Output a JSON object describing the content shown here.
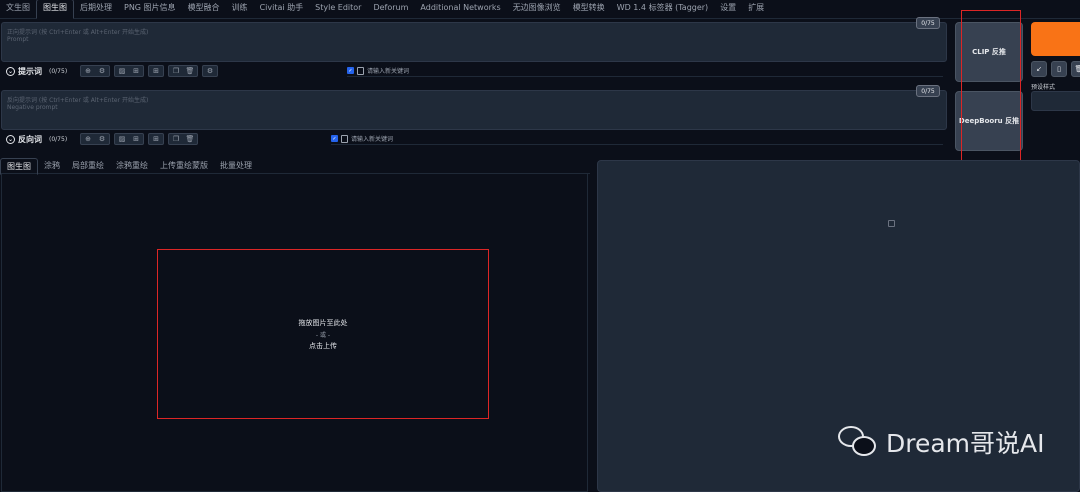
{
  "nav_tabs": [
    "文生图",
    "图生图",
    "后期处理",
    "PNG 图片信息",
    "模型融合",
    "训练",
    "Civitai 助手",
    "Style Editor",
    "Deforum",
    "Additional Networks",
    "无边图像浏览",
    "模型转换",
    "WD 1.4 标签器 (Tagger)",
    "设置",
    "扩展"
  ],
  "active_nav": "图生图",
  "prompt": {
    "hint_cn": "正向提示词 (按 Ctrl+Enter 或 Alt+Enter 开始生成)",
    "hint_en": "Prompt",
    "counter": "0/75",
    "title": "提示词",
    "title_count": "(0/75)",
    "keyword_placeholder": "请输入新关键词"
  },
  "negative": {
    "hint_cn": "反向提示词 (按 Ctrl+Enter 或 Alt+Enter 开始生成)",
    "hint_en": "Negative prompt",
    "counter": "0/75",
    "title": "反向词",
    "title_count": "(0/75)",
    "keyword_placeholder": "请输入新关键词"
  },
  "side": {
    "clip_label": "CLIP 反推",
    "deepbooru_label": "DeepBooru 反推",
    "styles_label": "预设样式"
  },
  "sub_tabs": [
    "图生图",
    "涂鸦",
    "局部重绘",
    "涂鸦重绘",
    "上传重绘蒙版",
    "批量处理"
  ],
  "upload": {
    "line1": "拖放图片至此处",
    "line2": "- 或 -",
    "line3": "点击上传"
  },
  "watermark": "Dream哥说AI",
  "colors": {
    "accent": "#f97316",
    "highlight": "#dc2626"
  }
}
